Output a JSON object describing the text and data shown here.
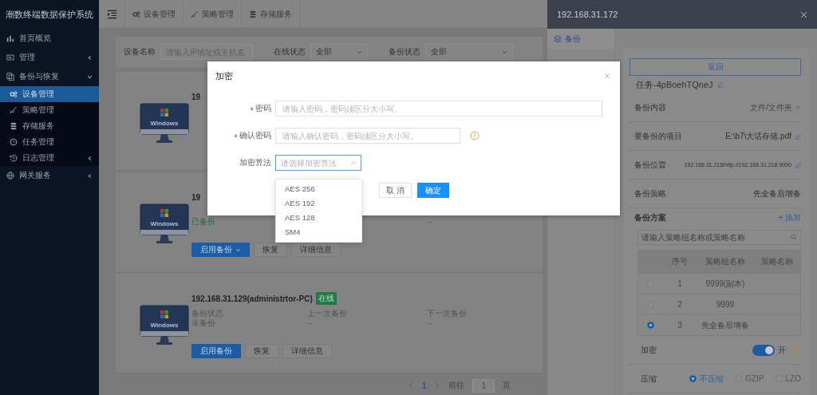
{
  "sidebar": {
    "title": "潮数终端数据保护系统",
    "items": [
      {
        "label": "首页概览",
        "kind": "link",
        "selected": false
      },
      {
        "label": "管理",
        "kind": "group",
        "expanded": false,
        "selected": false
      },
      {
        "label": "备份与恢复",
        "kind": "group",
        "expanded": true,
        "selected": false,
        "children": [
          {
            "label": "设备管理",
            "kind": "link",
            "selected": true
          },
          {
            "label": "策略管理",
            "kind": "link",
            "selected": false
          },
          {
            "label": "存储服务",
            "kind": "link",
            "selected": false
          },
          {
            "label": "任务管理",
            "kind": "link",
            "selected": false
          },
          {
            "label": "日志管理",
            "kind": "group",
            "expanded": false,
            "selected": false
          }
        ]
      },
      {
        "label": "网关服务",
        "kind": "group",
        "expanded": false,
        "selected": false
      }
    ]
  },
  "topbar": {
    "tabs": [
      {
        "label": "设备管理"
      },
      {
        "label": "策略管理"
      },
      {
        "label": "存储服务"
      }
    ]
  },
  "filter": {
    "fields": [
      {
        "label": "设备名称",
        "kind": "input",
        "placeholder": "请输入IP地址或主机名"
      },
      {
        "label": "在线状态",
        "kind": "select",
        "value": "全部"
      },
      {
        "label": "备份状态",
        "kind": "select",
        "value": "全部"
      }
    ]
  },
  "devices": [
    {
      "ip": "19",
      "os_label": "Windows"
    },
    {
      "ip": "19",
      "os_label": "Windows",
      "status": {
        "value": "已备份",
        "backed_up": true
      },
      "next": {
        "value": "--"
      },
      "buttons": [
        {
          "label": "启用备份",
          "kind": "primary",
          "menu": true
        },
        {
          "label": "恢复",
          "kind": "default",
          "menu": false
        },
        {
          "label": "详细信息",
          "kind": "default",
          "menu": false
        }
      ]
    },
    {
      "ip": "192.168.31.129(administrtor-PC)",
      "online": true,
      "tag": "在线",
      "os_label": "Windows",
      "status": {
        "label": "备份状态",
        "value": "未备份",
        "backed_up": false
      },
      "last": {
        "label": "上一次备份",
        "value": "--"
      },
      "next": {
        "label": "下一次备份",
        "value": "--"
      },
      "buttons": [
        {
          "label": "启用备份",
          "kind": "primary",
          "menu": false
        },
        {
          "label": "恢复",
          "kind": "default",
          "menu": false
        },
        {
          "label": "详细信息",
          "kind": "default",
          "menu": false
        }
      ]
    }
  ],
  "pagination": {
    "pages": [
      {
        "label": "1",
        "selected": true
      }
    ],
    "goto_label": "前往",
    "goto_value": "1",
    "suffix": "页"
  },
  "modal": {
    "title": "加密",
    "fields": [
      {
        "label": "密码",
        "kind": "input",
        "required": true,
        "warning": false,
        "placeholder": "请输入密码，密码须区分大小写。"
      },
      {
        "label": "确认密码",
        "kind": "input",
        "required": true,
        "warning": true,
        "placeholder": "请输入确认密码，密码须区分大小写。"
      },
      {
        "label": "加密算法",
        "kind": "select",
        "required": false,
        "open": true,
        "placeholder": "请选择加密算法",
        "options": [
          "AES 256",
          "AES 192",
          "AES 128",
          "SM4"
        ]
      }
    ],
    "buttons": [
      {
        "label": "取 消",
        "kind": "default"
      },
      {
        "label": "确定",
        "kind": "primary"
      }
    ]
  },
  "drawer": {
    "title": "192.168.31.172",
    "tabs": [
      {
        "label": "备份",
        "selected": true
      }
    ],
    "back_button": "返回",
    "task_name": "任务-4pBoehTQneJ",
    "fields": [
      {
        "label": "备份内容",
        "value": "文件/文件夹",
        "kind": "select"
      },
      {
        "label": "要备份的项目",
        "value": "E:\\b7\\大话存储.pdf",
        "kind": "editable"
      },
      {
        "label": "备份位置",
        "value": "192.168.31.218/http://192.168.31.218:9000",
        "kind": "editable"
      },
      {
        "label": "备份策略",
        "value": "先全备后增备",
        "kind": "text"
      }
    ],
    "plan": {
      "label": "备份方案",
      "add": "+ 添加",
      "search_placeholder": "请输入策略组名称或策略名称",
      "columns": [
        "序号",
        "策略组名称",
        "策略名称"
      ],
      "rows": [
        {
          "cells": [
            "1",
            "9999(副本)"
          ],
          "selected": false
        },
        {
          "cells": [
            "2",
            "9999"
          ],
          "selected": false
        },
        {
          "cells": [
            "3",
            "先全备后增备"
          ],
          "selected": true
        }
      ]
    },
    "encryption": {
      "label": "加密",
      "on": true,
      "state_text": "开",
      "info": true
    },
    "compression": {
      "label": "压缩",
      "options": [
        {
          "label": "不压缩",
          "selected": true
        },
        {
          "label": "GZIP",
          "selected": false
        },
        {
          "label": "LZO",
          "selected": false
        }
      ]
    }
  }
}
